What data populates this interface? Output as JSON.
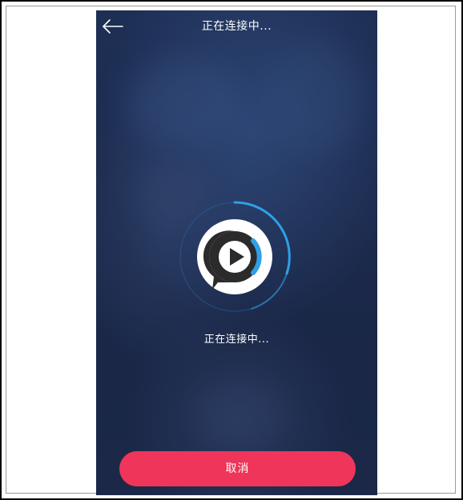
{
  "nav": {
    "title": "正在连接中...",
    "back_icon": "arrow-left-icon"
  },
  "main": {
    "status_text": "正在连接中...",
    "logo_icon": "play-chat-logo-icon",
    "spinner_icon": "loading-ring-icon"
  },
  "actions": {
    "cancel_label": "取消"
  },
  "colors": {
    "background": "#1c2a4d",
    "accent_blue": "#2fa0e6",
    "cancel_button": "#f0355a",
    "logo_dark": "#2b2b2b",
    "text": "#ffffff"
  }
}
